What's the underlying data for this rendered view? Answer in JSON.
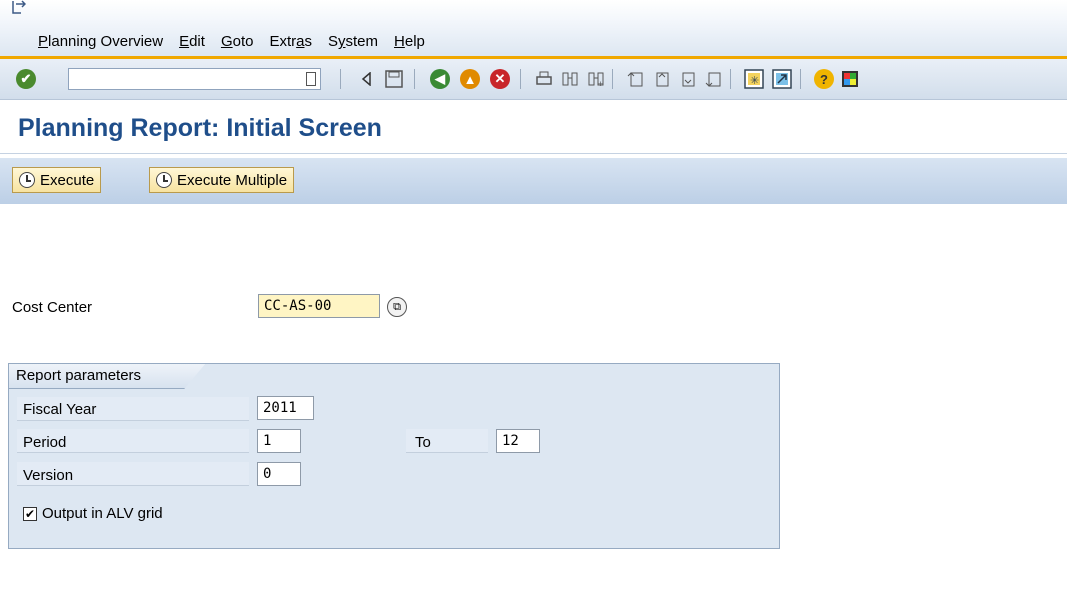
{
  "menubar": {
    "items": [
      {
        "label": "Planning Overview",
        "underline": "P"
      },
      {
        "label": "Edit",
        "underline": "E"
      },
      {
        "label": "Goto",
        "underline": "G"
      },
      {
        "label": "Extras",
        "underline": "a"
      },
      {
        "label": "System",
        "underline": "y"
      },
      {
        "label": "Help",
        "underline": "H"
      }
    ]
  },
  "toolbar": {
    "command_field_value": "",
    "icons": [
      "enter-icon",
      "back-arrow-icon",
      "save-icon",
      "back-icon",
      "exit-icon",
      "cancel-icon",
      "print-icon",
      "find-icon",
      "find-next-icon",
      "first-page-icon",
      "previous-page-icon",
      "next-page-icon",
      "last-page-icon",
      "create-session-icon",
      "shortcut-icon",
      "help-icon",
      "layout-menu-icon"
    ]
  },
  "page": {
    "title": "Planning Report: Initial Screen"
  },
  "app_toolbar": {
    "execute_label": "Execute",
    "execute_multiple_label": "Execute Multiple"
  },
  "form": {
    "cost_center_label": "Cost Center",
    "cost_center_value": "CC-AS-00",
    "group_title": "Report parameters",
    "fiscal_year_label": "Fiscal Year",
    "fiscal_year_value": "2011",
    "period_label": "Period",
    "period_from_value": "1",
    "period_to_label": "To",
    "period_to_value": "12",
    "version_label": "Version",
    "version_value": "0",
    "alv_label": "Output in ALV grid",
    "alv_checked": true
  },
  "colors": {
    "title": "#1f4e8a",
    "accent_line": "#f0a800",
    "required_field": "#fff5c4",
    "group_bg": "#dde7f2"
  }
}
